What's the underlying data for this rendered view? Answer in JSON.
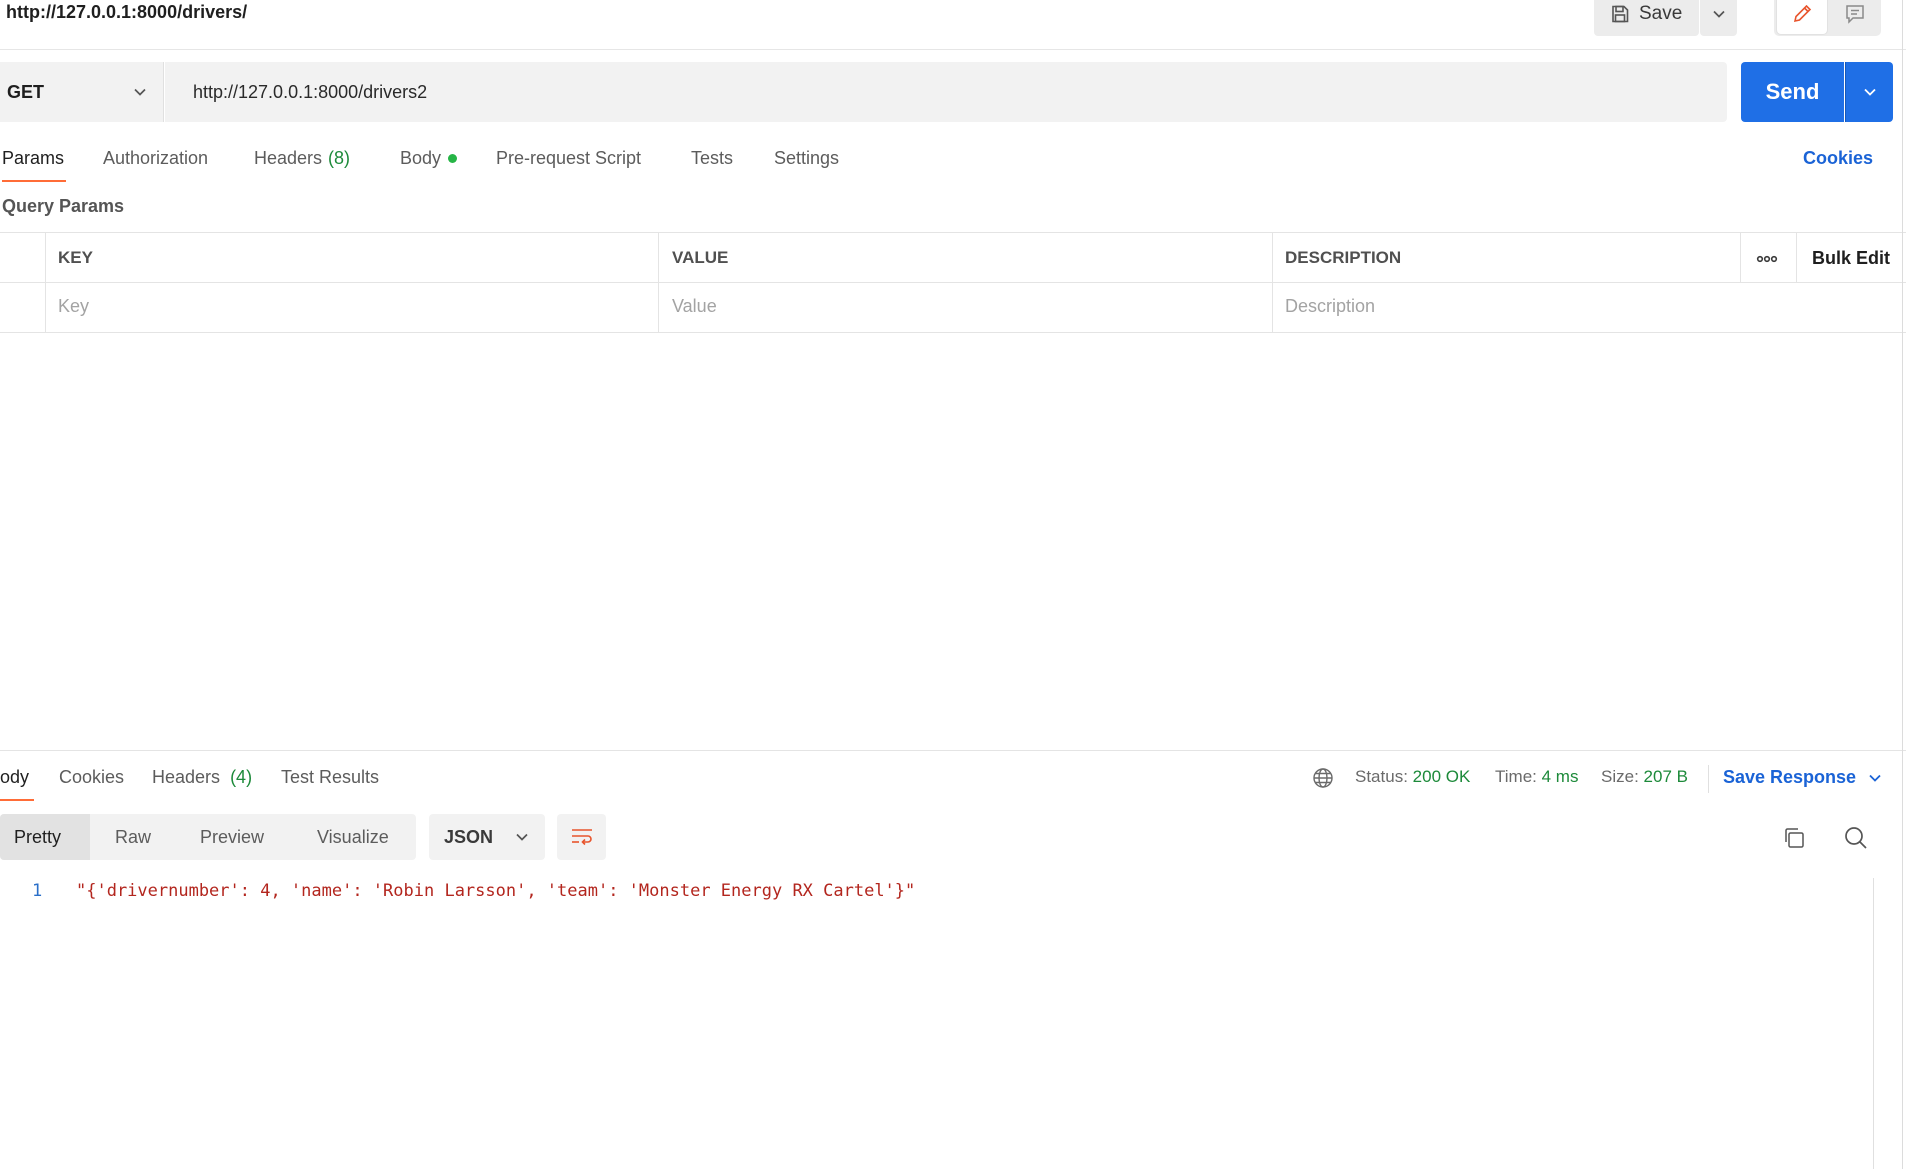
{
  "header": {
    "title": "http://127.0.0.1:8000/drivers/",
    "save_label": "Save"
  },
  "request": {
    "method": "GET",
    "url": "http://127.0.0.1:8000/drivers2",
    "send_label": "Send"
  },
  "request_tabs": {
    "params": "Params",
    "authorization": "Authorization",
    "headers": "Headers",
    "headers_count": "(8)",
    "body": "Body",
    "pre_request": "Pre-request Script",
    "tests": "Tests",
    "settings": "Settings",
    "cookies": "Cookies"
  },
  "params_table": {
    "section_label": "Query Params",
    "columns": {
      "key": "KEY",
      "value": "VALUE",
      "description": "DESCRIPTION"
    },
    "placeholders": {
      "key": "Key",
      "value": "Value",
      "description": "Description"
    },
    "bulk_edit": "Bulk Edit"
  },
  "response_tabs": {
    "body": "ody",
    "cookies": "Cookies",
    "headers": "Headers",
    "headers_count": "(4)",
    "test_results": "Test Results"
  },
  "response_meta": {
    "status_label": "Status:",
    "status_value": "200 OK",
    "time_label": "Time:",
    "time_value": "4 ms",
    "size_label": "Size:",
    "size_value": "207 B",
    "save_response": "Save Response"
  },
  "format_toolbar": {
    "views": [
      "Pretty",
      "Raw",
      "Preview",
      "Visualize"
    ],
    "language": "JSON"
  },
  "code": {
    "line_number": "1",
    "line_text": "\"{'drivernumber': 4, 'name': 'Robin Larsson', 'team': 'Monster Energy RX Cartel'}\""
  },
  "colors": {
    "accent_orange": "#ff6c37",
    "primary_blue": "#1f6fe6",
    "link_blue": "#1a63d6",
    "status_green": "#1d8a3a",
    "code_string_red": "#b3261e"
  },
  "icons": [
    "save-icon",
    "chevron-down-icon",
    "pencil-icon",
    "comment-icon",
    "more-horizontal-icon",
    "globe-icon",
    "wrap-lines-icon",
    "copy-icon",
    "search-icon"
  ]
}
